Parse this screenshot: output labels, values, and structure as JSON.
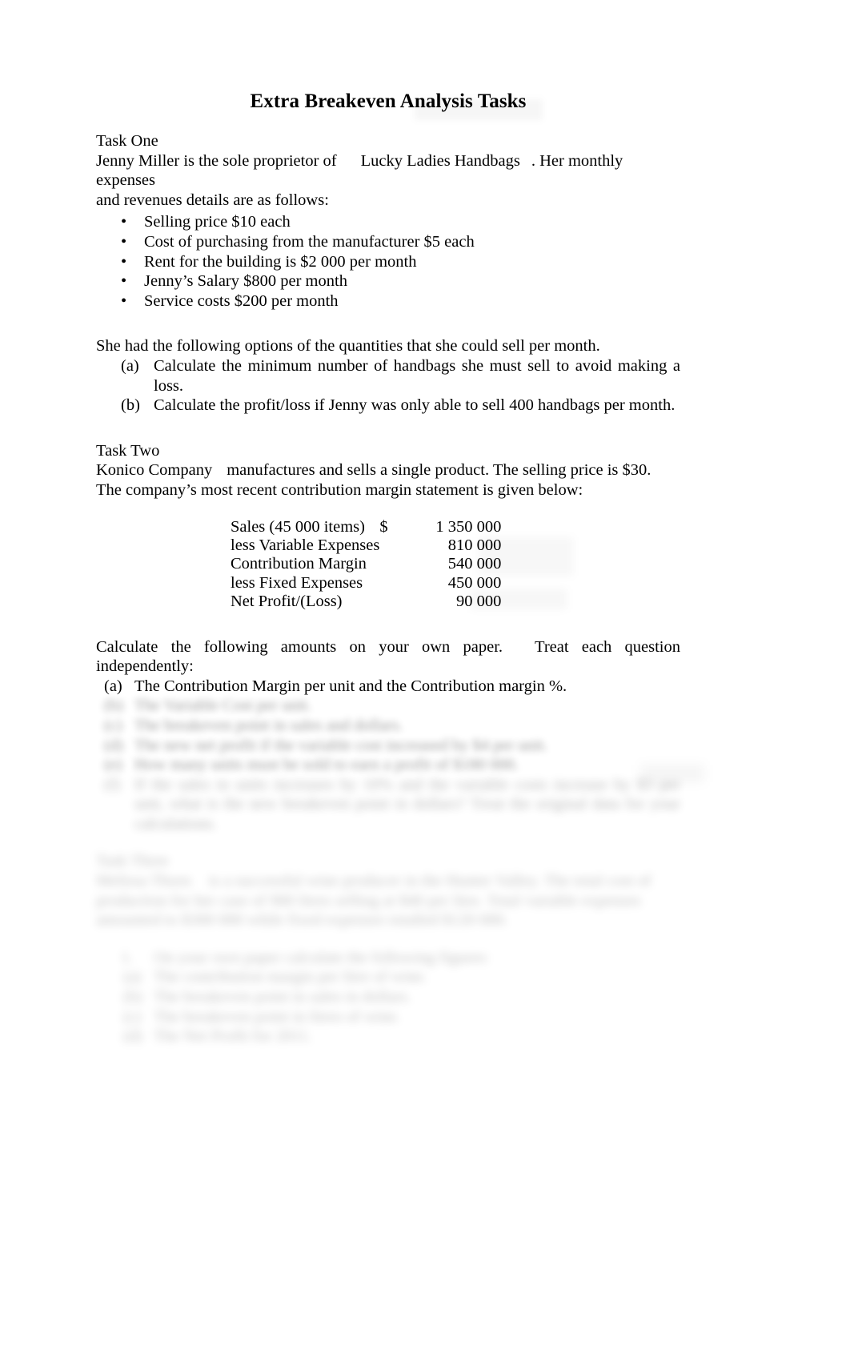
{
  "document": {
    "title": "Extra Breakeven Analysis Tasks"
  },
  "task_one": {
    "heading": "Task One",
    "intro_a": "Jenny Miller is the sole proprietor of",
    "intro_b": "Lucky Ladies Handbags",
    "intro_c": ". Her monthly expenses",
    "intro_line2": "and revenues details are as follows:",
    "bullet_marker": "•",
    "bullets": [
      "Selling price $10 each",
      "Cost of purchasing from the manufacturer $5 each",
      "Rent for the building is $2 000 per month",
      "Jenny’s Salary $800 per month",
      "Service costs $200 per month"
    ],
    "options_line": "She had the following options of the quantities that she could sell per month.",
    "questions": [
      {
        "marker": "(a)",
        "text": "Calculate the minimum number of handbags she must sell to avoid making a loss."
      },
      {
        "marker": "(b)",
        "text": "Calculate the profit/loss if Jenny was only able to sell 400 handbags per month."
      }
    ]
  },
  "task_two": {
    "heading": "Task Two",
    "intro_a": "Konico Company",
    "intro_b": "manufactures and sells a single product. The selling price is $30.",
    "intro_line2": "The company’s most recent contribution margin statement is given below:",
    "statement": {
      "rows": [
        {
          "label": "Sales (45 000 items)",
          "currency": "$",
          "amount": "1 350 000"
        },
        {
          "label": "less  Variable Expenses",
          "currency": "",
          "amount": "810 000"
        },
        {
          "label": "Contribution Margin",
          "currency": "",
          "amount": "540 000"
        },
        {
          "label": "less  Fixed Expenses",
          "currency": "",
          "amount": "450 000"
        },
        {
          "label": "Net Profit/(Loss)",
          "currency": "",
          "amount": "90 000"
        }
      ]
    },
    "instruction_a": "Calculate   the   following   amounts   on   your   own   paper.",
    "instruction_b": "Treat   each   question",
    "instruction_line2": "independently:",
    "questions": [
      {
        "marker": "(a)",
        "text": "The Contribution Margin per unit and the Contribution margin %."
      },
      {
        "marker": "(b)",
        "text": "The Variable Cost per unit."
      },
      {
        "marker": "(c)",
        "text": "The breakeven point in sales and dollars."
      },
      {
        "marker": "(d)",
        "text": "The new net profit if the variable cost increased by $4 per unit."
      },
      {
        "marker": "(e)",
        "text": "How many units must be sold to earn a profit of $180 000."
      },
      {
        "marker": "(f)",
        "text": "If the sales in units increases by 10% and the variable costs increase by $3 per unit, what is the new breakeven point in dollars? Treat the original data for your calculations."
      }
    ]
  },
  "task_three": {
    "heading": "Task Three",
    "intro_a": "Melissa Thorn",
    "intro_b": "is a successful wine producer in the Hunter Valley. The total cost of",
    "intro_line2": "production for her case of 900 litres selling at $40 per litre. Total variable expenses",
    "intro_line3": "amounted to $300 000 while fixed expenses totalled $120 000.",
    "instruction": "On your own paper calculate the following figures:",
    "questions": [
      {
        "marker": "(a)",
        "text": "The contribution margin per litre of wine."
      },
      {
        "marker": "(b)",
        "text": "The breakeven point in sales in dollars."
      },
      {
        "marker": "(c)",
        "text": "The breakeven point in litres of wine."
      },
      {
        "marker": "(d)",
        "text": "The Net Profit for 2011."
      }
    ]
  }
}
